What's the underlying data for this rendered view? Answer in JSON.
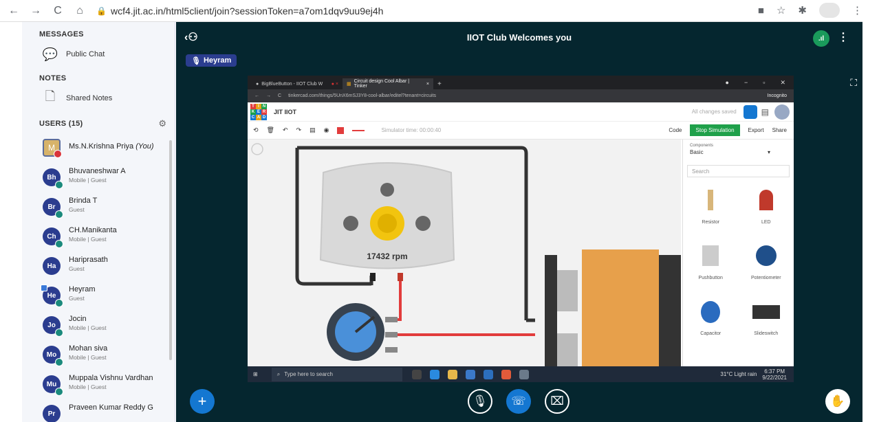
{
  "browser": {
    "url": "wcf4.jit.ac.in/html5client/join?sessionToken=a7om1dqv9uu9ej4h"
  },
  "sidebar": {
    "messages_title": "MESSAGES",
    "public_chat": "Public Chat",
    "notes_title": "NOTES",
    "shared_notes": "Shared Notes",
    "users_title": "USERS (15)",
    "users": [
      {
        "initials": "M",
        "name": "Ms.N.Krishna Priya",
        "you": "(You)",
        "role": ""
      },
      {
        "initials": "Bh",
        "name": "Bhuvaneshwar A",
        "role": "Mobile | Guest"
      },
      {
        "initials": "Br",
        "name": "Brinda T",
        "role": "Guest"
      },
      {
        "initials": "Ch",
        "name": "CH.Manikanta",
        "role": "Mobile | Guest"
      },
      {
        "initials": "Ha",
        "name": "Hariprasath",
        "role": "Guest"
      },
      {
        "initials": "He",
        "name": "Heyram",
        "role": "Guest"
      },
      {
        "initials": "Jo",
        "name": "Jocin",
        "role": "Mobile | Guest"
      },
      {
        "initials": "Mo",
        "name": "Mohan siva",
        "role": "Mobile | Guest"
      },
      {
        "initials": "Mu",
        "name": "Muppala Vishnu Vardhan",
        "role": "Mobile | Guest"
      },
      {
        "initials": "Pr",
        "name": "Praveen Kumar Reddy G",
        "role": ""
      }
    ]
  },
  "main": {
    "title": "IIOT Club Welcomes you",
    "talking": "Heyram"
  },
  "screenshare": {
    "tab1": "BigBlueButton - IIOT Club W",
    "tab2": "Circuit design Cool Albar | Tinker",
    "address": "tinkercad.com/things/5UnX6mSJ3Y8-cool-albar/editel?tenant=circuits",
    "incognito": "Incognito",
    "project": "JIT IIOT",
    "saved": "All changes saved",
    "sim_time": "Simulator time: 00:00:40",
    "code": "Code",
    "stop": "Stop Simulation",
    "export": "Export",
    "share": "Share",
    "rpm": "17432 rpm",
    "components_label": "Components",
    "components_value": "Basic",
    "search": "Search",
    "parts": [
      "Resistor",
      "LED",
      "Pushbutton",
      "Potentiometer",
      "Capacitor",
      "Slideswitch"
    ],
    "taskbar_search": "Type here to search",
    "weather": "31°C Light rain",
    "time": "6:37 PM",
    "date": "9/22/2021"
  }
}
